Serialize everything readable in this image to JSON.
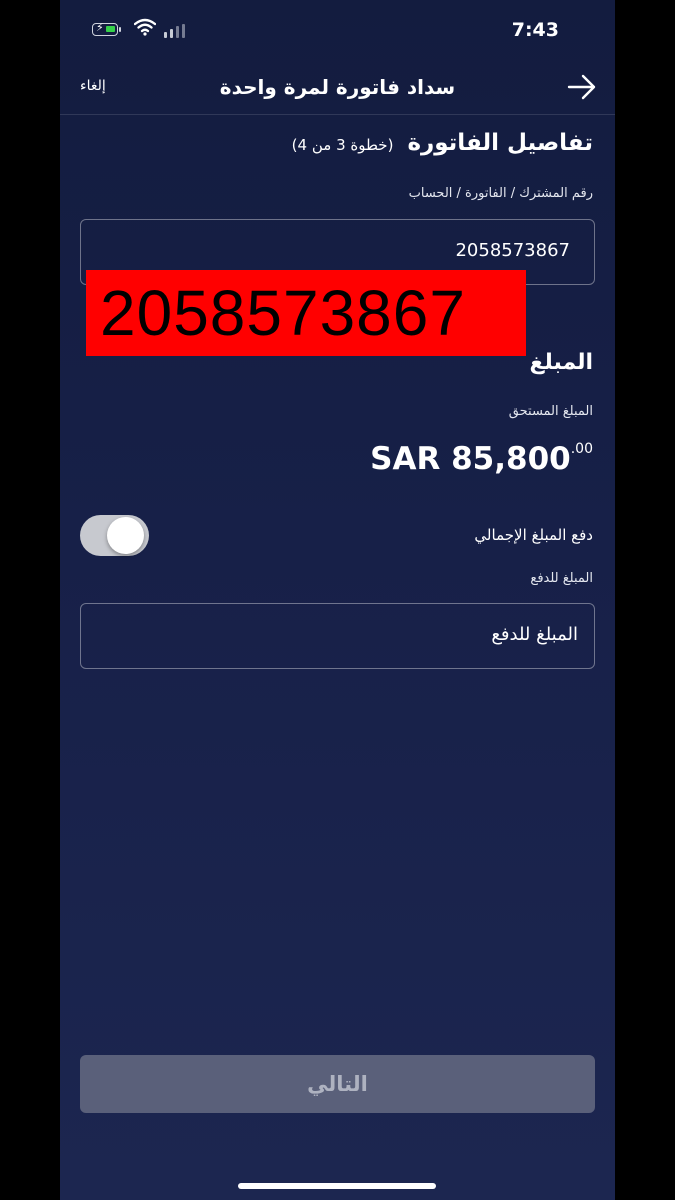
{
  "status_bar": {
    "time": "7:43"
  },
  "nav": {
    "title": "سداد فاتورة لمرة واحدة",
    "cancel_label": "إلغاء"
  },
  "bill_details": {
    "title": "تفاصيل الفاتورة",
    "step": "(خطوة 3 من 4)",
    "account_label": "رقم المشترك / الفاتورة / الحساب",
    "account_value": "2058573867",
    "redacted_overlay": "2058573867"
  },
  "amount": {
    "heading": "المبلغ",
    "due_label": "المبلغ المستحق",
    "due_currency_amount": "SAR 85,800",
    "due_decimals": ".00",
    "pay_total_label": "دفع المبلغ الإجمالي",
    "pay_total_toggle_on": false,
    "pay_amount_label": "المبلغ للدفع",
    "pay_amount_placeholder": "المبلغ للدفع"
  },
  "footer": {
    "next_label": "التالي"
  },
  "colors": {
    "background": "#172048",
    "redaction": "#ff0000",
    "button_disabled": "#5a607a",
    "battery_green": "#35d04a"
  },
  "icons": [
    "battery-charging-icon",
    "wifi-icon",
    "signal-icon",
    "arrow-right-icon"
  ]
}
